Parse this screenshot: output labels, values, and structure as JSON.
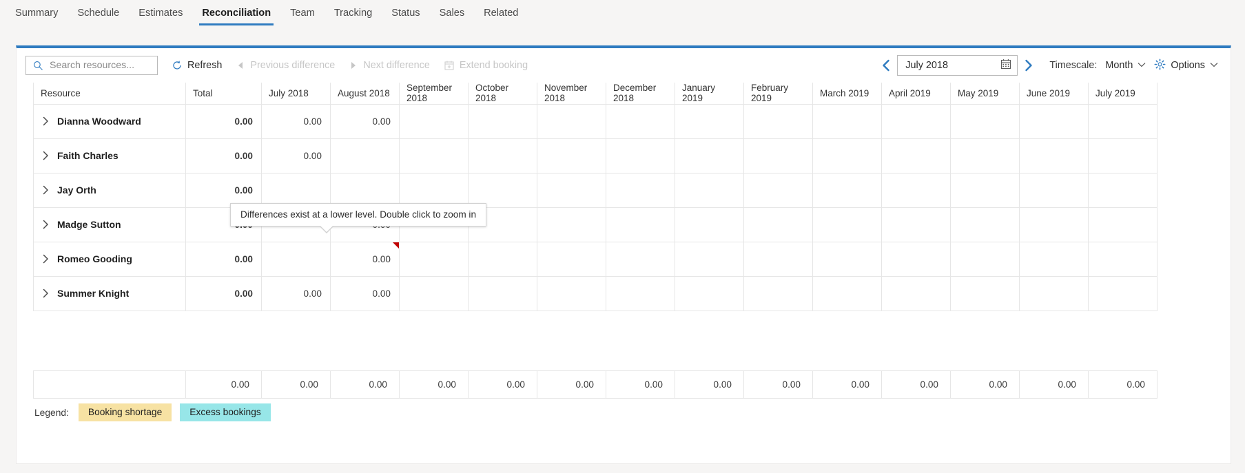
{
  "nav": {
    "tabs": [
      {
        "label": "Summary",
        "active": false
      },
      {
        "label": "Schedule",
        "active": false
      },
      {
        "label": "Estimates",
        "active": false
      },
      {
        "label": "Reconciliation",
        "active": true
      },
      {
        "label": "Team",
        "active": false
      },
      {
        "label": "Tracking",
        "active": false
      },
      {
        "label": "Status",
        "active": false
      },
      {
        "label": "Sales",
        "active": false
      },
      {
        "label": "Related",
        "active": false
      }
    ]
  },
  "toolbar": {
    "search_placeholder": "Search resources...",
    "search_value": "",
    "search_icon": "search-icon",
    "refresh_label": "Refresh",
    "refresh_icon": "refresh-icon",
    "previous_difference_label": "Previous difference",
    "previous_difference_icon": "triangle-left-icon",
    "next_difference_label": "Next difference",
    "next_difference_icon": "triangle-right-icon",
    "extend_booking_label": "Extend booking",
    "extend_booking_icon": "calendar-plus-icon",
    "prev_period_icon": "chevron-left-icon",
    "next_period_icon": "chevron-right-icon",
    "date_value": "July 2018",
    "calendar_icon": "calendar-icon",
    "timescale_label": "Timescale:",
    "timescale_value": "Month",
    "timescale_caret": "chevron-down-icon",
    "options_label": "Options",
    "options_icon": "gear-icon",
    "options_caret": "chevron-down-icon"
  },
  "grid": {
    "columns": [
      "Resource",
      "Total",
      "July 2018",
      "August 2018",
      "September 2018",
      "October 2018",
      "November 2018",
      "December 2018",
      "January 2019",
      "February 2019",
      "March 2019",
      "April 2019",
      "May 2019",
      "June 2019",
      "July 2019"
    ],
    "rows": [
      {
        "resource": "Dianna Woodward",
        "total": "0.00",
        "months": [
          "0.00",
          "0.00",
          "",
          "",
          "",
          "",
          "",
          "",
          "",
          "",
          "",
          "",
          ""
        ],
        "marks": [
          false,
          false,
          false,
          false,
          false,
          false,
          false,
          false,
          false,
          false,
          false,
          false,
          false
        ]
      },
      {
        "resource": "Faith Charles",
        "total": "0.00",
        "months": [
          "0.00",
          "",
          "",
          "",
          "",
          "",
          "",
          "",
          "",
          "",
          "",
          "",
          ""
        ],
        "marks": [
          false,
          false,
          false,
          false,
          false,
          false,
          false,
          false,
          false,
          false,
          false,
          false,
          false
        ]
      },
      {
        "resource": "Jay Orth",
        "total": "0.00",
        "months": [
          "",
          "",
          "",
          "",
          "",
          "",
          "",
          "",
          "",
          "",
          "",
          "",
          ""
        ],
        "marks": [
          false,
          false,
          false,
          false,
          false,
          false,
          false,
          false,
          false,
          false,
          false,
          false,
          false
        ]
      },
      {
        "resource": "Madge Sutton",
        "total": "0.00",
        "months": [
          "",
          "0.00",
          "",
          "",
          "",
          "",
          "",
          "",
          "",
          "",
          "",
          "",
          ""
        ],
        "marks": [
          false,
          true,
          false,
          false,
          false,
          false,
          false,
          false,
          false,
          false,
          false,
          false,
          false
        ]
      },
      {
        "resource": "Romeo Gooding",
        "total": "0.00",
        "months": [
          "",
          "0.00",
          "",
          "",
          "",
          "",
          "",
          "",
          "",
          "",
          "",
          "",
          ""
        ],
        "marks": [
          false,
          true,
          false,
          false,
          false,
          false,
          false,
          false,
          false,
          false,
          false,
          false,
          false
        ]
      },
      {
        "resource": "Summer Knight",
        "total": "0.00",
        "months": [
          "0.00",
          "0.00",
          "",
          "",
          "",
          "",
          "",
          "",
          "",
          "",
          "",
          "",
          ""
        ],
        "marks": [
          false,
          false,
          false,
          false,
          false,
          false,
          false,
          false,
          false,
          false,
          false,
          false,
          false
        ]
      }
    ],
    "expand_icon": "chevron-right-icon",
    "totals_row": {
      "resource": "",
      "total": "0.00",
      "months": [
        "0.00",
        "0.00",
        "0.00",
        "0.00",
        "0.00",
        "0.00",
        "0.00",
        "0.00",
        "0.00",
        "0.00",
        "0.00",
        "0.00",
        "0.00"
      ]
    }
  },
  "tooltip": {
    "text": "Differences exist at a lower level. Double click to zoom in"
  },
  "legend": {
    "label": "Legend:",
    "items": [
      {
        "text": "Booking shortage",
        "color": "#f7e2a3"
      },
      {
        "text": "Excess bookings",
        "color": "#97e6e8"
      }
    ]
  },
  "colors": {
    "accent": "#2f7bc0",
    "marker_red": "#c00000",
    "page_bg": "#f6f5f4"
  }
}
